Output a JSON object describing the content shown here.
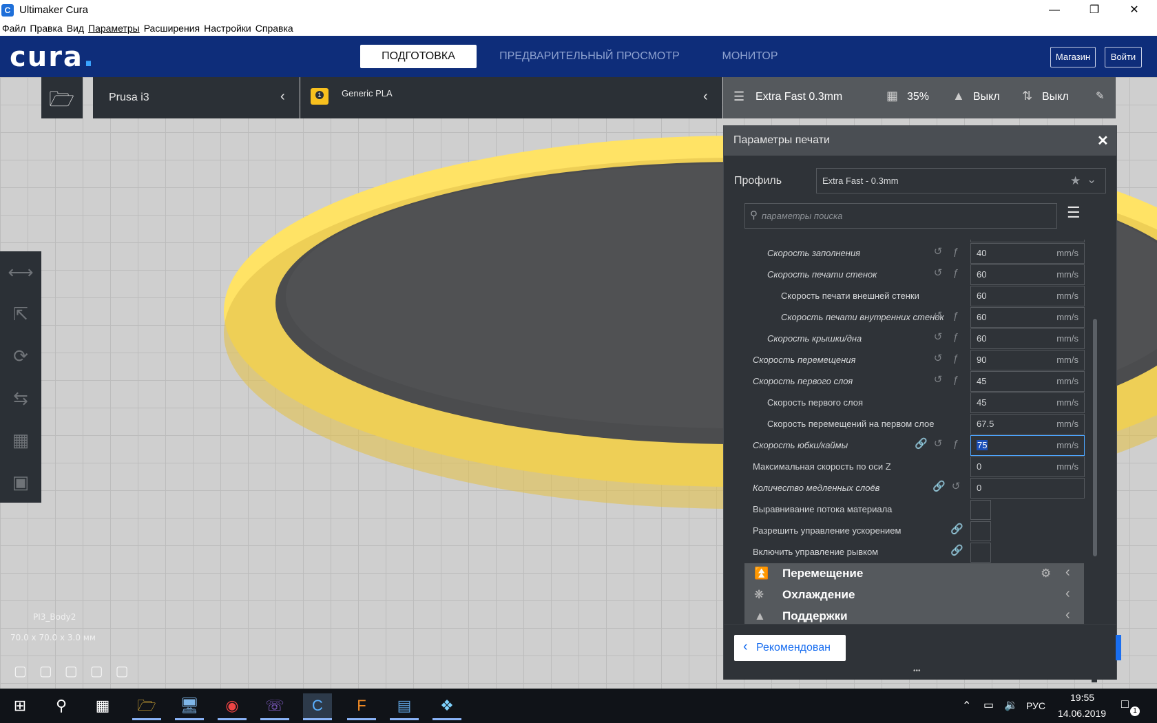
{
  "window": {
    "title": "Ultimaker Cura",
    "logo_letter": "C"
  },
  "menu": [
    "Файл",
    "Правка",
    "Вид",
    "Параметры",
    "Расширения",
    "Настройки",
    "Справка"
  ],
  "header": {
    "brand": "cura",
    "brand_dot": ".",
    "tabs": [
      "ПОДГОТОВКА",
      "ПРЕДВАРИТЕЛЬНЫЙ ПРОСМОТР",
      "МОНИТОР"
    ],
    "store": "Магазин",
    "login": "Войти"
  },
  "printer": {
    "name": "Prusa i3"
  },
  "material": {
    "extruder": "1",
    "name": "Generic PLA"
  },
  "profile_bar": {
    "name": "Extra Fast 0.3mm",
    "infill": "35%",
    "support": "Выкл",
    "adhesion": "Выкл"
  },
  "panel": {
    "title": "Параметры печати",
    "profile_label": "Профиль",
    "profile_value": "Extra Fast - 0.3mm",
    "search_placeholder": "параметры поиска",
    "rows": [
      {
        "label": "Скорость заполнения",
        "value": "40",
        "unit": "mm/s"
      },
      {
        "label": "Скорость печати стенок",
        "value": "60",
        "unit": "mm/s"
      },
      {
        "label": "Скорость печати внешней стенки",
        "value": "60",
        "unit": "mm/s"
      },
      {
        "label": "Скорость печати внутренних стенок",
        "value": "60",
        "unit": "mm/s"
      },
      {
        "label": "Скорость крышки/дна",
        "value": "60",
        "unit": "mm/s"
      },
      {
        "label": "Скорость перемещения",
        "value": "90",
        "unit": "mm/s"
      },
      {
        "label": "Скорость первого слоя",
        "value": "45",
        "unit": "mm/s"
      },
      {
        "label": "Скорость первого слоя",
        "value": "45",
        "unit": "mm/s"
      },
      {
        "label": "Скорость перемещений на первом слое",
        "value": "67.5",
        "unit": "mm/s"
      },
      {
        "label": "Скорость юбки/каймы",
        "value": "75",
        "unit": "mm/s"
      },
      {
        "label": "Максимальная скорость по оси Z",
        "value": "0",
        "unit": "mm/s"
      },
      {
        "label": "Количество медленных слоёв",
        "value": "0",
        "unit": ""
      },
      {
        "label": "Выравнивание потока материала",
        "value": "",
        "unit": ""
      },
      {
        "label": "Разрешить управление ускорением",
        "value": "",
        "unit": ""
      },
      {
        "label": "Включить управление рывком",
        "value": "",
        "unit": ""
      }
    ],
    "categories": [
      "Перемещение",
      "Охлаждение",
      "Поддержки"
    ],
    "recommended_button": "Рекомендован",
    "grip": "•••"
  },
  "object": {
    "name": "PI3_Body2",
    "size": "70.0 x 70.0 x 3.0 мм"
  },
  "taskbar": {
    "lang": "РУС",
    "time": "19:55",
    "date": "14.06.2019",
    "notif": "1"
  },
  "colors": {
    "accent": "#196ef0",
    "object": "#ffe262",
    "panel": "#2f3338",
    "header": "#0e2d7a"
  }
}
